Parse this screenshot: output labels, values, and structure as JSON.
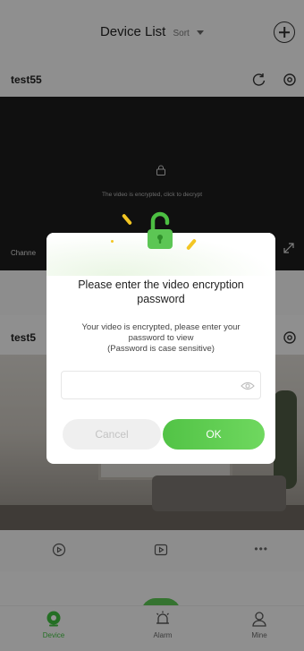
{
  "header": {
    "title": "Device List",
    "sort_label": "Sort"
  },
  "devices": [
    {
      "name": "test55",
      "encrypted_text": "The video is encrypted, click to decrypt",
      "channel_label": "Channe"
    },
    {
      "name": "test5"
    }
  ],
  "dialog": {
    "title": "Please enter the video encryption password",
    "message_line1": "Your video is encrypted, please enter your",
    "message_line2": "password to view",
    "message_line3": "(Password is case sensitive)",
    "password_value": "",
    "cancel_label": "Cancel",
    "ok_label": "OK"
  },
  "tabs": [
    {
      "label": "Device",
      "icon": "device-icon",
      "active": true
    },
    {
      "label": "Alarm",
      "icon": "alarm-icon",
      "active": false
    },
    {
      "label": "Mine",
      "icon": "user-icon",
      "active": false
    }
  ],
  "colors": {
    "accent_green": "#52c346",
    "dark_video": "#1c1c1c",
    "overlay": "rgba(0,0,0,0.42)"
  }
}
